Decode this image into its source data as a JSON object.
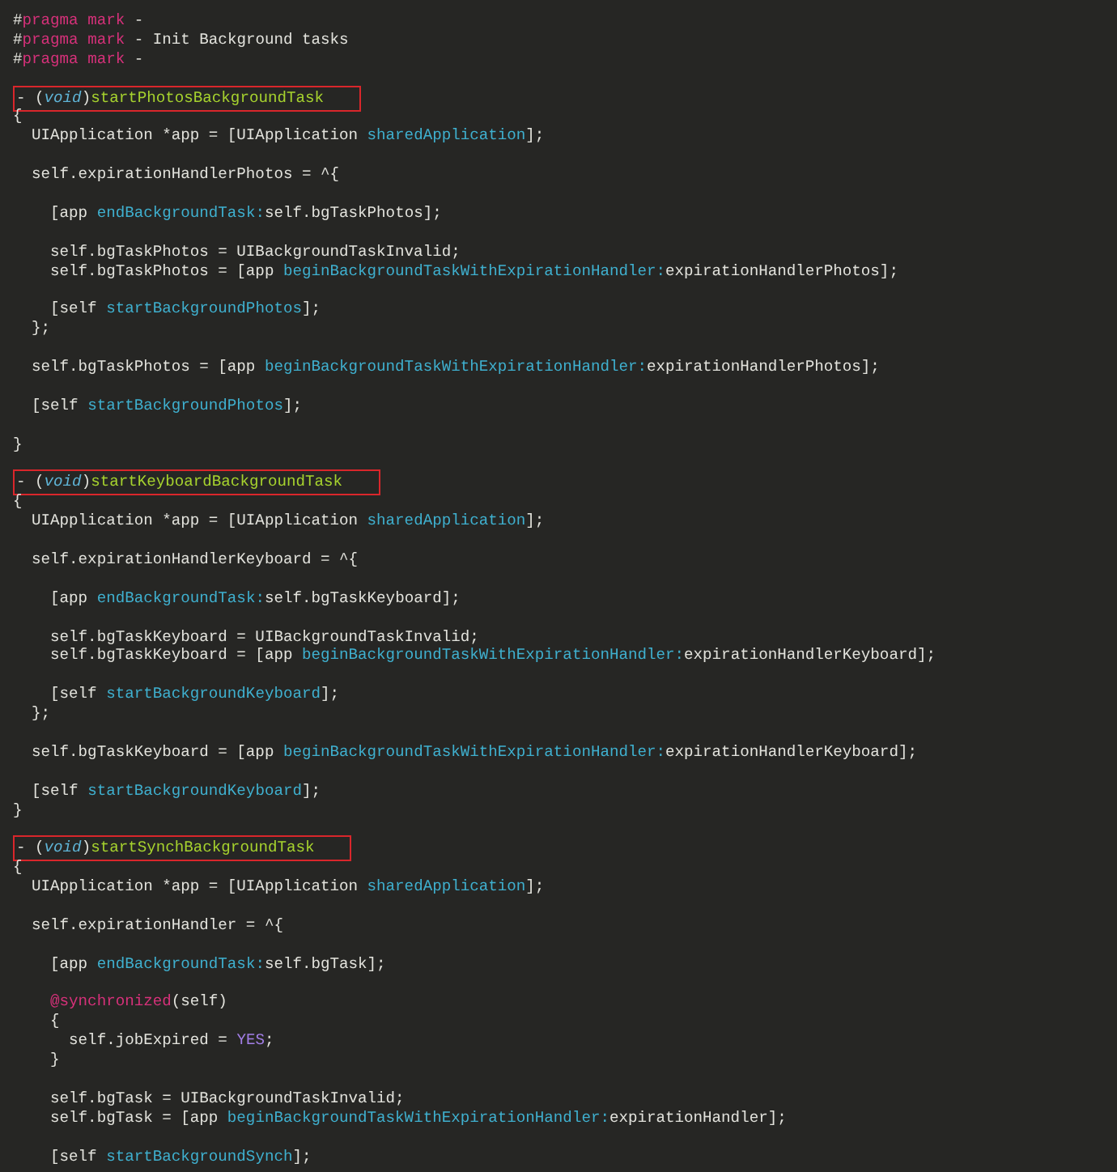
{
  "editor": {
    "lines": [
      {
        "kind": "code",
        "tokens": [
          {
            "kind": "plain",
            "text": "#"
          },
          {
            "kind": "preproc",
            "text": "pragma mark"
          },
          {
            "kind": "plain",
            "text": " -"
          }
        ]
      },
      {
        "kind": "code",
        "tokens": [
          {
            "kind": "plain",
            "text": "#"
          },
          {
            "kind": "preproc",
            "text": "pragma mark"
          },
          {
            "kind": "plain",
            "text": " - Init Background tasks"
          }
        ]
      },
      {
        "kind": "code",
        "tokens": [
          {
            "kind": "plain",
            "text": "#"
          },
          {
            "kind": "preproc",
            "text": "pragma mark"
          },
          {
            "kind": "plain",
            "text": " -"
          }
        ]
      },
      {
        "kind": "blank"
      },
      {
        "kind": "code",
        "boxed": true,
        "tokens": [
          {
            "kind": "plain",
            "text": "- ("
          },
          {
            "kind": "keyword",
            "text": "void"
          },
          {
            "kind": "plain",
            "text": ")"
          },
          {
            "kind": "method",
            "text": "startPhotosBackgroundTask"
          }
        ]
      },
      {
        "kind": "code",
        "tokens": [
          {
            "kind": "plain",
            "text": "{"
          }
        ]
      },
      {
        "kind": "code",
        "tokens": [
          {
            "kind": "plain",
            "text": "  UIApplication *app = [UIApplication "
          },
          {
            "kind": "message",
            "text": "sharedApplication"
          },
          {
            "kind": "plain",
            "text": "];"
          }
        ]
      },
      {
        "kind": "blank"
      },
      {
        "kind": "code",
        "tokens": [
          {
            "kind": "plain",
            "text": "  self.expirationHandlerPhotos = ^{"
          }
        ]
      },
      {
        "kind": "blank"
      },
      {
        "kind": "code",
        "tokens": [
          {
            "kind": "plain",
            "text": "    [app "
          },
          {
            "kind": "message",
            "text": "endBackgroundTask:"
          },
          {
            "kind": "plain",
            "text": "self.bgTaskPhotos];"
          }
        ]
      },
      {
        "kind": "blank"
      },
      {
        "kind": "code",
        "tokens": [
          {
            "kind": "plain",
            "text": "    self.bgTaskPhotos = UIBackgroundTaskInvalid;"
          }
        ]
      },
      {
        "kind": "code",
        "tokens": [
          {
            "kind": "plain",
            "text": "    self.bgTaskPhotos = [app "
          },
          {
            "kind": "message",
            "text": "beginBackgroundTaskWithExpirationHandler:"
          },
          {
            "kind": "plain",
            "text": "expirationHandlerPhotos];"
          }
        ]
      },
      {
        "kind": "blank"
      },
      {
        "kind": "code",
        "tokens": [
          {
            "kind": "plain",
            "text": "    [self "
          },
          {
            "kind": "message",
            "text": "startBackgroundPhotos"
          },
          {
            "kind": "plain",
            "text": "];"
          }
        ]
      },
      {
        "kind": "code",
        "tokens": [
          {
            "kind": "plain",
            "text": "  };"
          }
        ]
      },
      {
        "kind": "blank"
      },
      {
        "kind": "code",
        "tokens": [
          {
            "kind": "plain",
            "text": "  self.bgTaskPhotos = [app "
          },
          {
            "kind": "message",
            "text": "beginBackgroundTaskWithExpirationHandler:"
          },
          {
            "kind": "plain",
            "text": "expirationHandlerPhotos];"
          }
        ]
      },
      {
        "kind": "blank"
      },
      {
        "kind": "code",
        "tokens": [
          {
            "kind": "plain",
            "text": "  [self "
          },
          {
            "kind": "message",
            "text": "startBackgroundPhotos"
          },
          {
            "kind": "plain",
            "text": "];"
          }
        ]
      },
      {
        "kind": "blank"
      },
      {
        "kind": "code",
        "tokens": [
          {
            "kind": "plain",
            "text": "}"
          }
        ]
      },
      {
        "kind": "blank"
      },
      {
        "kind": "code",
        "boxed": true,
        "tokens": [
          {
            "kind": "plain",
            "text": "- ("
          },
          {
            "kind": "keyword",
            "text": "void"
          },
          {
            "kind": "plain",
            "text": ")"
          },
          {
            "kind": "method",
            "text": "startKeyboardBackgroundTask"
          }
        ]
      },
      {
        "kind": "code",
        "tokens": [
          {
            "kind": "plain",
            "text": "{"
          }
        ]
      },
      {
        "kind": "code",
        "tokens": [
          {
            "kind": "plain",
            "text": "  UIApplication *app = [UIApplication "
          },
          {
            "kind": "message",
            "text": "sharedApplication"
          },
          {
            "kind": "plain",
            "text": "];"
          }
        ]
      },
      {
        "kind": "blank"
      },
      {
        "kind": "code",
        "tokens": [
          {
            "kind": "plain",
            "text": "  self.expirationHandlerKeyboard = ^{"
          }
        ]
      },
      {
        "kind": "blank"
      },
      {
        "kind": "code",
        "tokens": [
          {
            "kind": "plain",
            "text": "    [app "
          },
          {
            "kind": "message",
            "text": "endBackgroundTask:"
          },
          {
            "kind": "plain",
            "text": "self.bgTaskKeyboard];"
          }
        ]
      },
      {
        "kind": "blank"
      },
      {
        "kind": "code",
        "tokens": [
          {
            "kind": "plain",
            "text": "    self.bgTaskKeyboard = UIBackgroundTaskInvalid;"
          }
        ]
      },
      {
        "kind": "code",
        "tokens": [
          {
            "kind": "plain",
            "text": "    self.bgTaskKeyboard = [app "
          },
          {
            "kind": "message",
            "text": "beginBackgroundTaskWithExpirationHandler:"
          },
          {
            "kind": "plain",
            "text": "expirationHandlerKeyboard];"
          }
        ]
      },
      {
        "kind": "blank"
      },
      {
        "kind": "code",
        "tokens": [
          {
            "kind": "plain",
            "text": "    [self "
          },
          {
            "kind": "message",
            "text": "startBackgroundKeyboard"
          },
          {
            "kind": "plain",
            "text": "];"
          }
        ]
      },
      {
        "kind": "code",
        "tokens": [
          {
            "kind": "plain",
            "text": "  };"
          }
        ]
      },
      {
        "kind": "blank"
      },
      {
        "kind": "code",
        "tokens": [
          {
            "kind": "plain",
            "text": "  self.bgTaskKeyboard = [app "
          },
          {
            "kind": "message",
            "text": "beginBackgroundTaskWithExpirationHandler:"
          },
          {
            "kind": "plain",
            "text": "expirationHandlerKeyboard];"
          }
        ]
      },
      {
        "kind": "blank"
      },
      {
        "kind": "code",
        "tokens": [
          {
            "kind": "plain",
            "text": "  [self "
          },
          {
            "kind": "message",
            "text": "startBackgroundKeyboard"
          },
          {
            "kind": "plain",
            "text": "];"
          }
        ]
      },
      {
        "kind": "code",
        "tokens": [
          {
            "kind": "plain",
            "text": "}"
          }
        ]
      },
      {
        "kind": "blank"
      },
      {
        "kind": "code",
        "boxed": true,
        "tokens": [
          {
            "kind": "plain",
            "text": "- ("
          },
          {
            "kind": "keyword",
            "text": "void"
          },
          {
            "kind": "plain",
            "text": ")"
          },
          {
            "kind": "method",
            "text": "startSynchBackgroundTask"
          }
        ]
      },
      {
        "kind": "code",
        "tokens": [
          {
            "kind": "plain",
            "text": "{"
          }
        ]
      },
      {
        "kind": "code",
        "tokens": [
          {
            "kind": "plain",
            "text": "  UIApplication *app = [UIApplication "
          },
          {
            "kind": "message",
            "text": "sharedApplication"
          },
          {
            "kind": "plain",
            "text": "];"
          }
        ]
      },
      {
        "kind": "blank"
      },
      {
        "kind": "code",
        "tokens": [
          {
            "kind": "plain",
            "text": "  self.expirationHandler = ^{"
          }
        ]
      },
      {
        "kind": "blank"
      },
      {
        "kind": "code",
        "tokens": [
          {
            "kind": "plain",
            "text": "    [app "
          },
          {
            "kind": "message",
            "text": "endBackgroundTask:"
          },
          {
            "kind": "plain",
            "text": "self.bgTask];"
          }
        ]
      },
      {
        "kind": "blank"
      },
      {
        "kind": "code",
        "tokens": [
          {
            "kind": "directive",
            "text": "    @synchronized"
          },
          {
            "kind": "plain",
            "text": "(self)"
          }
        ]
      },
      {
        "kind": "code",
        "tokens": [
          {
            "kind": "plain",
            "text": "    {"
          }
        ]
      },
      {
        "kind": "code",
        "tokens": [
          {
            "kind": "plain",
            "text": "      self.jobExpired = "
          },
          {
            "kind": "constant",
            "text": "YES"
          },
          {
            "kind": "plain",
            "text": ";"
          }
        ]
      },
      {
        "kind": "code",
        "tokens": [
          {
            "kind": "plain",
            "text": "    }"
          }
        ]
      },
      {
        "kind": "blank"
      },
      {
        "kind": "code",
        "tokens": [
          {
            "kind": "plain",
            "text": "    self.bgTask = UIBackgroundTaskInvalid;"
          }
        ]
      },
      {
        "kind": "code",
        "tokens": [
          {
            "kind": "plain",
            "text": "    self.bgTask = [app "
          },
          {
            "kind": "message",
            "text": "beginBackgroundTaskWithExpirationHandler:"
          },
          {
            "kind": "plain",
            "text": "expirationHandler];"
          }
        ]
      },
      {
        "kind": "blank"
      },
      {
        "kind": "code",
        "tokens": [
          {
            "kind": "plain",
            "text": "    [self "
          },
          {
            "kind": "message",
            "text": "startBackgroundSynch"
          },
          {
            "kind": "plain",
            "text": "];"
          }
        ]
      }
    ]
  }
}
